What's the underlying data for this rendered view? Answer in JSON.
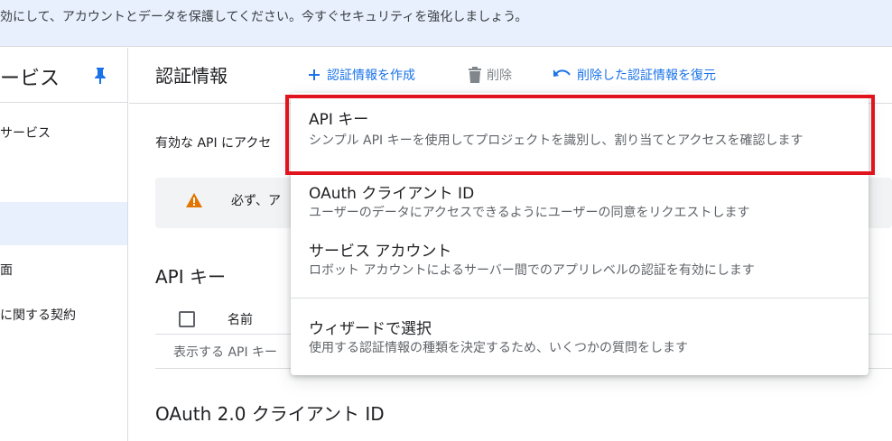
{
  "banner": {
    "text": "効にして、アカウントとデータを保護してください。今すぐセキュリティを強化しましょう。"
  },
  "sidebar": {
    "title": "ービス",
    "items": [
      {
        "label": "サービス"
      },
      {
        "label": ""
      },
      {
        "label": "面"
      },
      {
        "label": "に関する契約"
      }
    ]
  },
  "header": {
    "title": "認証情報",
    "create_label": "認証情報を作成",
    "delete_label": "削除",
    "restore_label": "削除した認証情報を復元"
  },
  "content": {
    "apis_text": "有効な API にアクセ",
    "warning_text": "必ず、ア",
    "api_keys_title": "API キー",
    "name_col": "名前",
    "empty_text": "表示する API キー",
    "oauth_title": "OAuth 2.0 クライアント ID"
  },
  "menu": {
    "items": [
      {
        "title": "API キー",
        "desc": "シンプル API キーを使用してプロジェクトを識別し、割り当てとアクセスを確認します"
      },
      {
        "title": "OAuth クライアント ID",
        "desc": "ユーザーのデータにアクセスできるようにユーザーの同意をリクエストします"
      },
      {
        "title": "サービス アカウント",
        "desc": "ロボット アカウントによるサーバー間でのアプリレベルの認証を有効にします"
      },
      {
        "title": "ウィザードで選択",
        "desc": "使用する認証情報の種類を決定するため、いくつかの質問をします"
      }
    ]
  },
  "colors": {
    "accent": "#1a73e8",
    "highlight": "#e1141e",
    "warning": "#e37400"
  }
}
